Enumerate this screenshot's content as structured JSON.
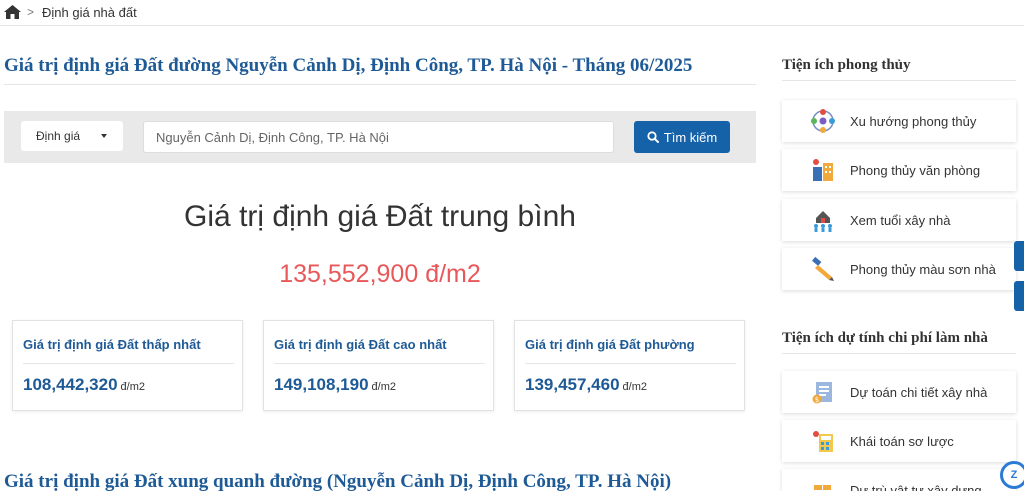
{
  "breadcrumb": {
    "items": [
      "Định giá nhà đất"
    ]
  },
  "main": {
    "title": "Giá trị định giá Đất đường Nguyễn Cảnh Dị, Định Công, TP. Hà Nội - Tháng 06/2025",
    "search": {
      "dropdown_value": "Định giá",
      "placeholder": "Nguyễn Cảnh Dị, Định Công, TP. Hà Nội",
      "button_label": "Tìm kiếm"
    },
    "average": {
      "heading": "Giá trị định giá Đất trung bình",
      "value": "135,552,900 đ/m2"
    },
    "stats": [
      {
        "label": "Giá trị định giá Đất thấp nhất",
        "value": "108,442,320",
        "unit": "đ/m2"
      },
      {
        "label": "Giá trị định giá Đất cao nhất",
        "value": "149,108,190",
        "unit": "đ/m2"
      },
      {
        "label": "Giá trị định giá Đất phường",
        "value": "139,457,460",
        "unit": "đ/m2"
      }
    ],
    "section_title": "Giá trị định giá Đất xung quanh đường (Nguyễn Cảnh Dị, Định Công, TP. Hà Nội)"
  },
  "sidebar": {
    "feng_shui": {
      "title": "Tiện ích phong thủy",
      "items": [
        {
          "label": "Xu hướng phong thủy",
          "icon": "compass-icon"
        },
        {
          "label": "Phong thủy văn phòng",
          "icon": "office-icon"
        },
        {
          "label": "Xem tuổi xây nhà",
          "icon": "house-people-icon"
        },
        {
          "label": "Phong thủy màu sơn nhà",
          "icon": "paint-brush-icon"
        }
      ]
    },
    "cost": {
      "title": "Tiện ích dự tính chi phí làm nhà",
      "items": [
        {
          "label": "Dự toán chi tiết xây nhà",
          "icon": "estimate-document-icon"
        },
        {
          "label": "Khái toán sơ lược",
          "icon": "calculator-icon"
        },
        {
          "label": "Dự trù vật tư xây dựng",
          "icon": "bricks-icon"
        }
      ]
    }
  },
  "widgets": {
    "chat_label": "Z"
  },
  "colors": {
    "primary": "#1e5a96",
    "button": "#1562a8",
    "average_value": "#e8585a",
    "panel_bg": "#e9e9e9"
  }
}
